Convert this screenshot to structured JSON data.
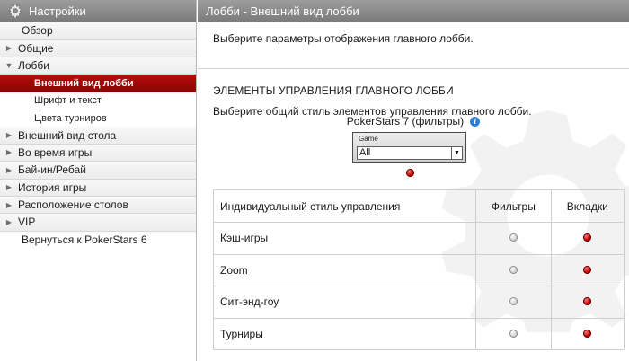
{
  "sidebar": {
    "title": "Настройки",
    "items": [
      {
        "label": "Обзор",
        "arrow": ""
      },
      {
        "label": "Общие",
        "arrow": "▶"
      },
      {
        "label": "Лобби",
        "arrow": "▼"
      },
      {
        "label": "Внешний вид лобби",
        "sub": true,
        "active": true
      },
      {
        "label": "Шрифт и текст",
        "sub": true
      },
      {
        "label": "Цвета турниров",
        "sub": true
      },
      {
        "label": "Внешний вид стола",
        "arrow": "▶"
      },
      {
        "label": "Во время игры",
        "arrow": "▶"
      },
      {
        "label": "Бай-ин/Ребай",
        "arrow": "▶"
      },
      {
        "label": "История игры",
        "arrow": "▶"
      },
      {
        "label": "Расположение столов",
        "arrow": "▶"
      },
      {
        "label": "VIP",
        "arrow": "▶"
      },
      {
        "label": "Вернуться к PokerStars 6",
        "arrow": ""
      }
    ]
  },
  "main": {
    "title": "Лобби - Внешний вид лобби",
    "intro": "Выберите параметры отображения главного лобби.",
    "section_title": "ЭЛЕМЕНТЫ УПРАВЛЕНИЯ ГЛАВНОГО ЛОББИ",
    "section_desc": "Выберите общий стиль элементов управления главного лобби.",
    "picker": {
      "label": "PokerStars 7 (фильтры)",
      "info_icon": "info-icon",
      "combo_caption": "Game",
      "combo_value": "All",
      "selected": true
    },
    "table": {
      "headers": [
        "Индивидуальный стиль управления",
        "Фильтры",
        "Вкладки"
      ],
      "rows": [
        {
          "label": "Кэш-игры",
          "filters": false,
          "tabs": true
        },
        {
          "label": "Zoom",
          "filters": false,
          "tabs": true
        },
        {
          "label": "Сит-энд-гоу",
          "filters": false,
          "tabs": true
        },
        {
          "label": "Турниры",
          "filters": false,
          "tabs": true
        }
      ]
    }
  },
  "colors": {
    "header": "#8a8a8a",
    "active_item": "#a10808",
    "radio_selected": "#c00000"
  }
}
